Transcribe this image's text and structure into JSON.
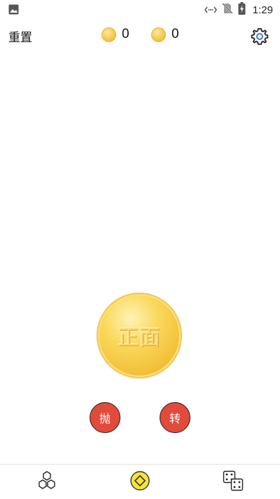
{
  "status_bar": {
    "time": "1:29",
    "icons": [
      "image-icon",
      "signal-icon",
      "no-sim-icon",
      "battery-charging-icon"
    ]
  },
  "header": {
    "reset_label": "重置",
    "heads_count": "0",
    "tails_count": "0",
    "settings_icon": "gear-icon"
  },
  "coin": {
    "face_text": "正面",
    "color": "#f3c03a"
  },
  "actions": {
    "toss_label": "抛",
    "spin_label": "转",
    "button_color": "#e24a3b"
  },
  "bottom_nav": {
    "items": [
      {
        "icon": "hexagons-icon",
        "active": false
      },
      {
        "icon": "coin-icon",
        "active": true
      },
      {
        "icon": "dice-icon",
        "active": false
      }
    ]
  }
}
